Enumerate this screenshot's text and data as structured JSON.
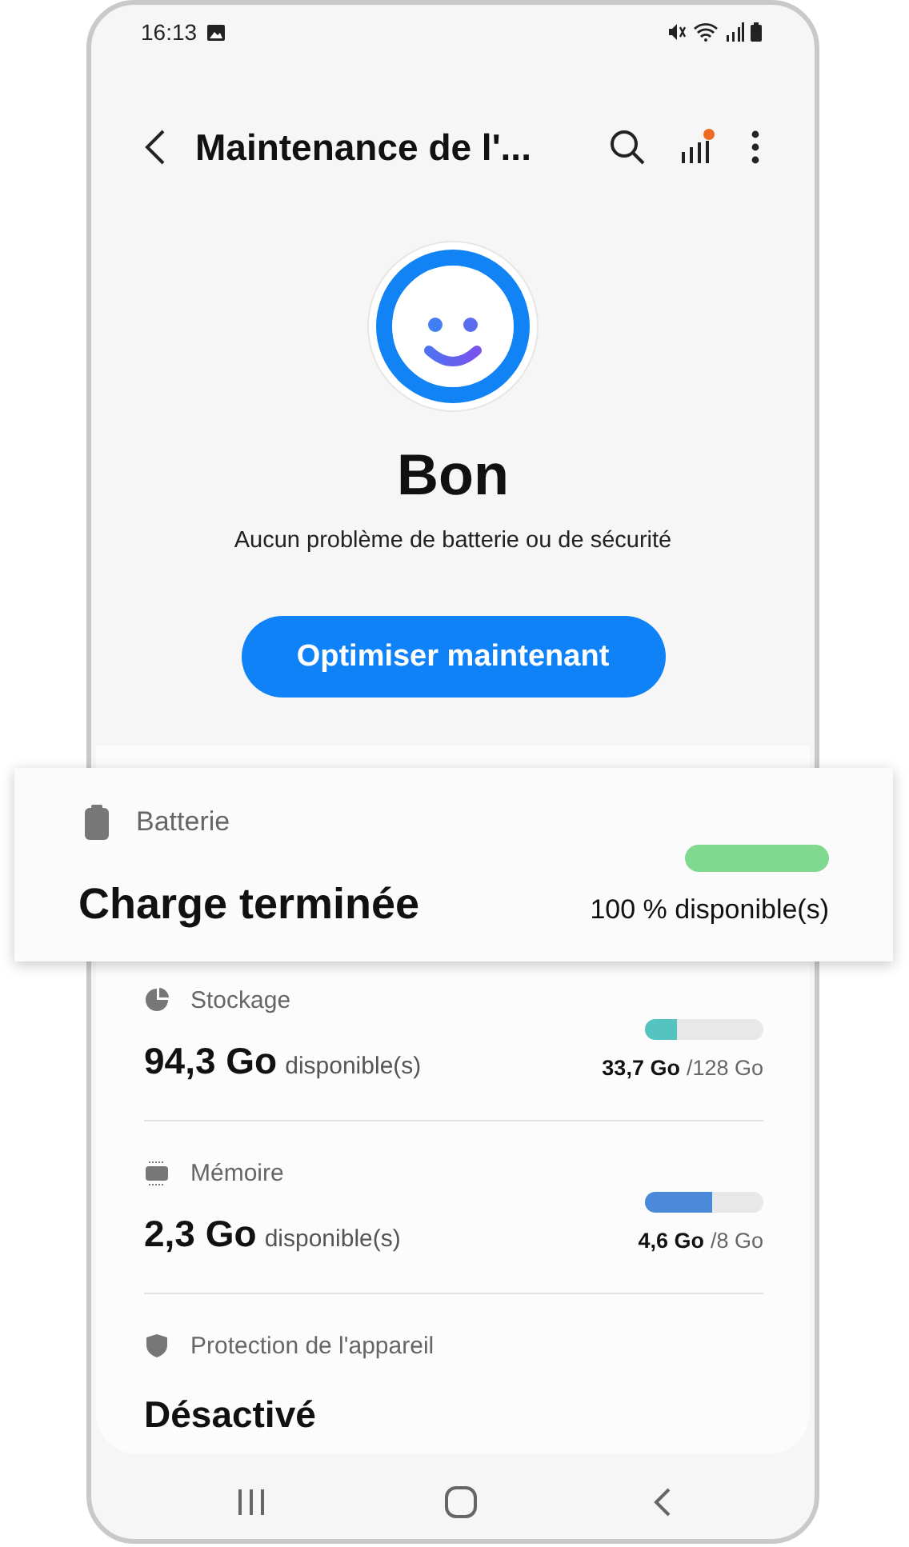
{
  "status_bar": {
    "time": "16:13"
  },
  "header": {
    "title": "Maintenance de l'..."
  },
  "summary": {
    "title": "Bon",
    "message": "Aucun problème de batterie ou de sécurité"
  },
  "primary_button": {
    "label": "Optimiser maintenant"
  },
  "battery": {
    "label": "Batterie",
    "value": "Charge terminée",
    "level": 1,
    "reading": "100 % disponible(s)"
  },
  "items": [
    {
      "kind": "usage",
      "label": "Stockage",
      "value": "94,3 Go",
      "unit": "disponible(s)",
      "level": 0.27,
      "color": "#55c4c0",
      "used": "33,7 Go",
      "total": "/128 Go"
    },
    {
      "kind": "usage",
      "label": "Mémoire",
      "value": "2,3 Go",
      "unit": "disponible(s)",
      "level": 0.57,
      "color": "#4a8ad8",
      "used": "4,6 Go",
      "total": "/8 Go"
    },
    {
      "kind": "status",
      "label": "Protection de l'appareil",
      "value": "Désactivé"
    }
  ]
}
